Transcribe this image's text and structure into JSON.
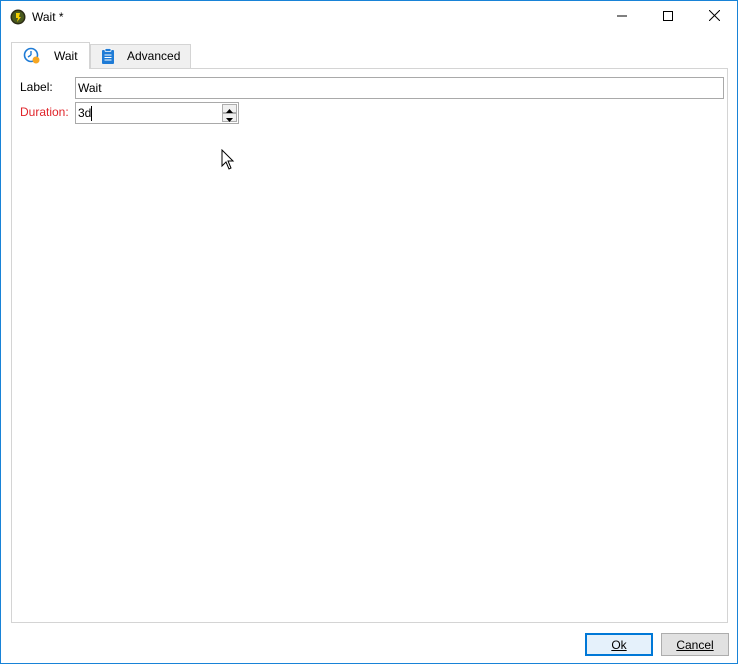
{
  "window": {
    "title": "Wait *",
    "accent_color": "#1883d7"
  },
  "caption": {
    "minimize_icon": "minimize-icon",
    "maximize_icon": "maximize-icon",
    "close_icon": "close-icon"
  },
  "tabs": [
    {
      "label": "Wait",
      "icon": "clock-icon",
      "active": true
    },
    {
      "label": "Advanced",
      "icon": "clipboard-icon",
      "active": false
    }
  ],
  "form": {
    "label_caption": "Label:",
    "label_value": "Wait",
    "duration_caption": "Duration:",
    "duration_value": "3d",
    "duration_color": "#e0242a"
  },
  "buttons": {
    "ok_label": "Ok",
    "cancel_label": "Cancel"
  }
}
